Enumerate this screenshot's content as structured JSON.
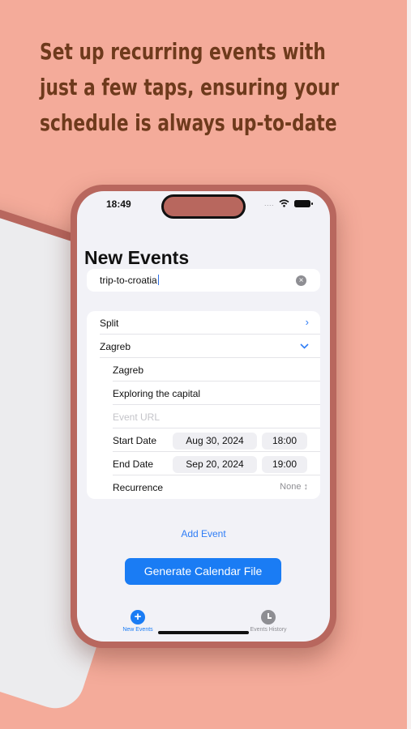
{
  "headline": {
    "line1": "Set up recurring events with",
    "line2": "just a few taps, ensuring your",
    "line3": "schedule is always up-to-date"
  },
  "status_bar": {
    "time": "18:49",
    "signal": "....",
    "icons": [
      "wifi-icon",
      "battery-icon"
    ]
  },
  "screen": {
    "title": "New Events",
    "search": {
      "value": "trip-to-croatia",
      "clear_icon": "clear-icon"
    },
    "events": {
      "collapsed": {
        "label": "Split",
        "chevron": "chevron-right-icon"
      },
      "expanded": {
        "label": "Zagreb",
        "chevron": "chevron-down-icon"
      },
      "fields": {
        "name": "Zagreb",
        "description": "Exploring the capital",
        "url_placeholder": "Event URL",
        "start_label": "Start Date",
        "start_date": "Aug 30, 2024",
        "start_time": "18:00",
        "end_label": "End Date",
        "end_date": "Sep 20, 2024",
        "end_time": "19:00",
        "recurrence_label": "Recurrence",
        "recurrence_value": "None ↕"
      }
    },
    "add_event": "Add Event",
    "generate_button": "Generate Calendar File",
    "tabs": [
      {
        "label": "New Events",
        "icon": "plus-circle-icon",
        "active": true
      },
      {
        "label": "Events History",
        "icon": "clock-icon",
        "active": false
      }
    ]
  },
  "colors": {
    "background": "#f4ab9a",
    "headline": "#6e3a1c",
    "phone_frame": "#b8675e",
    "accent": "#1a7cf4"
  }
}
